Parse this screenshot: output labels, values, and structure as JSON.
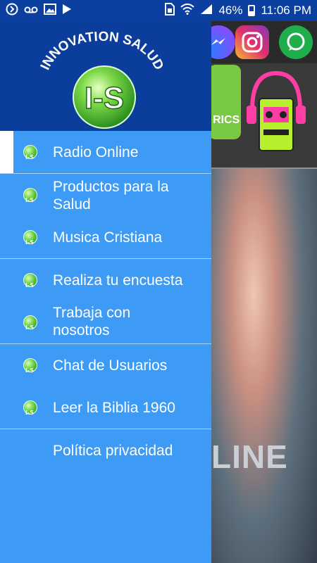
{
  "status_bar": {
    "battery": "46%",
    "time": "11:06 PM",
    "icons": [
      "app-notification-icon",
      "voicemail-icon",
      "image-icon",
      "play-icon",
      "sim-icon",
      "wifi-icon",
      "signal-icon",
      "battery-icon"
    ]
  },
  "drawer": {
    "logo_text": "INNOVATION SALUD",
    "logo_monogram": "I-S",
    "items": [
      {
        "label": "Radio Online",
        "icon": "innovation-salud-icon",
        "selected": true
      },
      {
        "label": "Productos para la Salud",
        "icon": "innovation-salud-icon"
      },
      {
        "label": "Musica Cristiana",
        "icon": "innovation-salud-icon"
      },
      {
        "label": "Realiza tu encuesta",
        "icon": "innovation-salud-icon"
      },
      {
        "label": "Trabaja con nosotros",
        "icon": "innovation-salud-icon"
      },
      {
        "label": "Chat de Usuarios",
        "icon": "innovation-salud-icon"
      },
      {
        "label": "Leer la Biblia 1960",
        "icon": "innovation-salud-icon"
      },
      {
        "label": "Política privacidad"
      }
    ]
  },
  "background": {
    "tile_text": "RICS",
    "banner_text": "LINE"
  },
  "colors": {
    "header": "#0a3d9c",
    "drawer": "#3d9bf5",
    "divider": "#a9d2fb"
  }
}
